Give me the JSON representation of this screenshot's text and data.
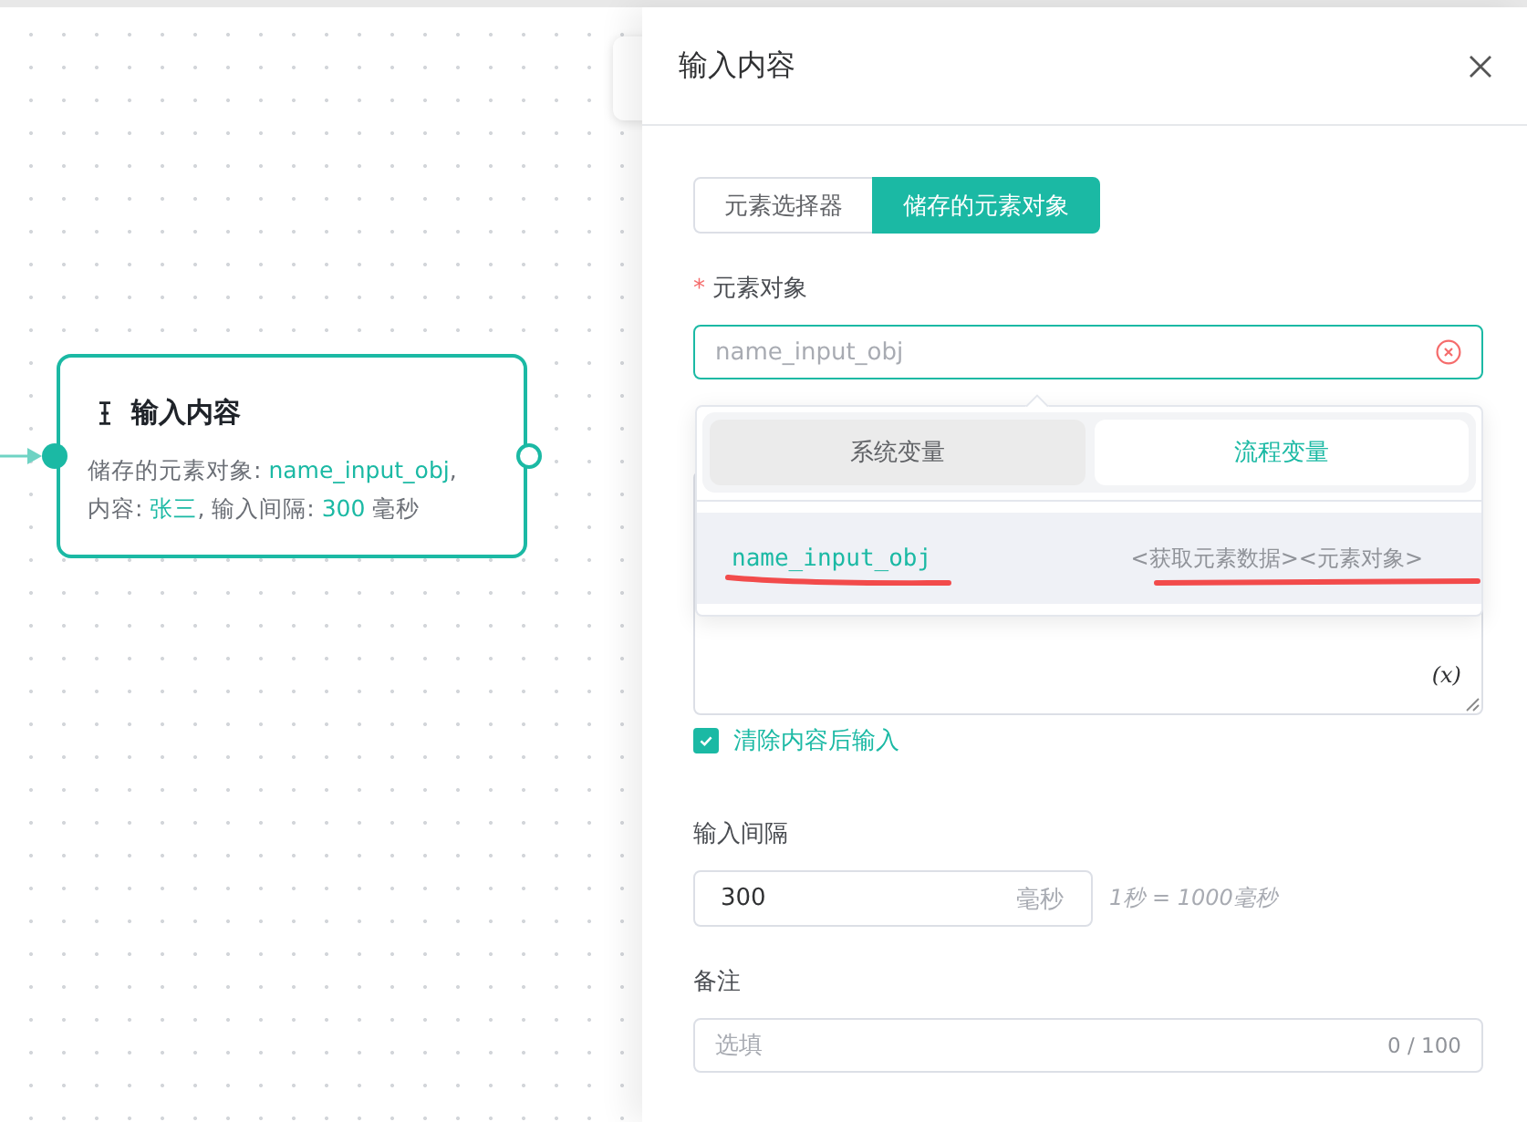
{
  "canvas": {
    "node": {
      "title": "输入内容",
      "description": [
        [
          {
            "kind": "label",
            "text": "储存的元素对象: "
          },
          {
            "kind": "value",
            "text": "name_input_obj"
          },
          {
            "kind": "label",
            "text": ","
          }
        ],
        [
          {
            "kind": "label",
            "text": "内容: "
          },
          {
            "kind": "value",
            "text": "张三"
          },
          {
            "kind": "label",
            "text": ", 输入间隔: "
          },
          {
            "kind": "value",
            "text": "300"
          },
          {
            "kind": "label",
            "text": " 毫秒"
          }
        ]
      ]
    }
  },
  "drawer": {
    "title": "输入内容",
    "mode_tabs": [
      {
        "label": "元素选择器",
        "selected": false
      },
      {
        "label": "储存的元素对象",
        "selected": true
      }
    ],
    "element_field": {
      "required_mark": "*",
      "label": "元素对象",
      "placeholder": "name_input_obj",
      "focused": true
    },
    "variable_dropdown": {
      "tabs": [
        {
          "label": "系统变量",
          "selected": false
        },
        {
          "label": "流程变量",
          "selected": true
        }
      ],
      "options": [
        {
          "name": "name_input_obj",
          "source": "<获取元素数据><元素对象>",
          "selected": true,
          "underlined": true
        }
      ]
    },
    "content_field": {
      "variable_button": "(x)"
    },
    "clear_before_input": {
      "label": "清除内容后输入",
      "checked": true
    },
    "interval_field": {
      "label": "输入间隔",
      "value": "300",
      "suffix": "毫秒",
      "hint": "1秒 = 1000毫秒"
    },
    "remark_field": {
      "label": "备注",
      "placeholder": "选填",
      "counter": "0 / 100"
    }
  }
}
